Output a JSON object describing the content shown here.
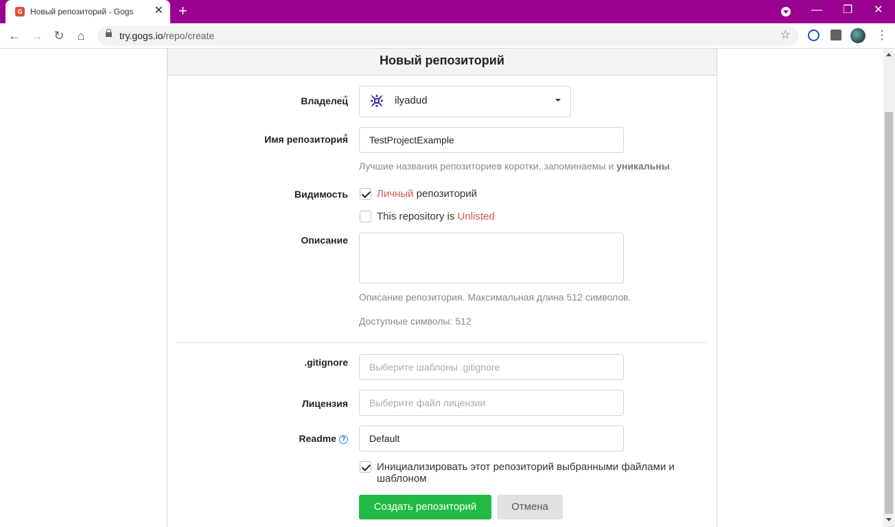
{
  "browser": {
    "tab_title": "Новый репозиторий - Gogs",
    "tab_favicon": "G",
    "url_host": "try.gogs.io",
    "url_path": "/repo/create"
  },
  "form": {
    "title": "Новый репозиторий",
    "owner": {
      "label": "Владелец",
      "value": "ilyadud"
    },
    "repo_name": {
      "label": "Имя репозитория",
      "value": "TestProjectExample",
      "help_prefix": "Лучшие названия репозиториев коротки, запоминаемы и ",
      "help_bold": "уникальны",
      "help_suffix": "."
    },
    "visibility": {
      "label": "Видимость",
      "private_highlight": "Личный",
      "private_rest": " репозиторий",
      "private_checked": true,
      "unlisted_prefix": "This repository is ",
      "unlisted_highlight": "Unlisted",
      "unlisted_checked": false
    },
    "description": {
      "label": "Описание",
      "value": "",
      "help": "Описание репозитория. Максимальная длина 512 символов.",
      "available": "Доступные символы: 512"
    },
    "gitignore": {
      "label": ".gitignore",
      "placeholder": "Выберите шаблоны .gitignore"
    },
    "license": {
      "label": "Лицензия",
      "placeholder": "Выберите файл лицензии"
    },
    "readme": {
      "label": "Readme",
      "value": "Default"
    },
    "auto_init": {
      "line1": "Инициализировать этот репозиторий выбранными файлами и",
      "line2": "шаблоном",
      "checked": true
    },
    "create_button": "Создать репозиторий",
    "cancel_button": "Отмена"
  },
  "colors": {
    "titlebar": "#9a0090",
    "primary_button": "#21ba45",
    "highlight_red": "#d9534f"
  }
}
